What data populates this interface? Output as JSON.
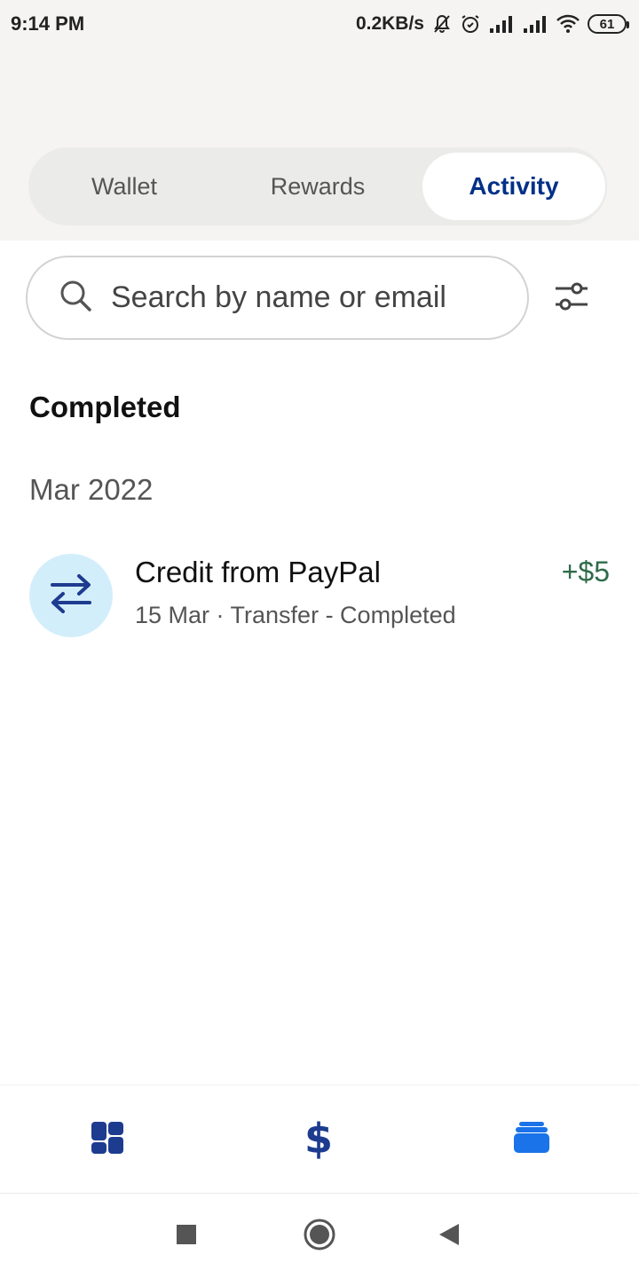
{
  "status_bar": {
    "time": "9:14 PM",
    "network_speed": "0.2KB/s",
    "battery": "61"
  },
  "tabs": [
    {
      "label": "Wallet",
      "active": false
    },
    {
      "label": "Rewards",
      "active": false
    },
    {
      "label": "Activity",
      "active": true
    }
  ],
  "search": {
    "placeholder": "Search by name or email",
    "value": ""
  },
  "section": {
    "title": "Completed",
    "month": "Mar 2022"
  },
  "transactions": [
    {
      "title": "Credit from PayPal",
      "subtitle": "15 Mar · Transfer - Completed",
      "amount": "+$5",
      "icon": "transfer-icon"
    }
  ],
  "bottom_nav": [
    {
      "icon": "dashboard-icon"
    },
    {
      "icon": "dollar-icon"
    },
    {
      "icon": "activity-stack-icon",
      "active": true
    }
  ],
  "colors": {
    "brand_navy": "#003087",
    "active_blue": "#1a73e8",
    "amount_green": "#2e6b4a",
    "avatar_bg": "#d3eefb"
  }
}
